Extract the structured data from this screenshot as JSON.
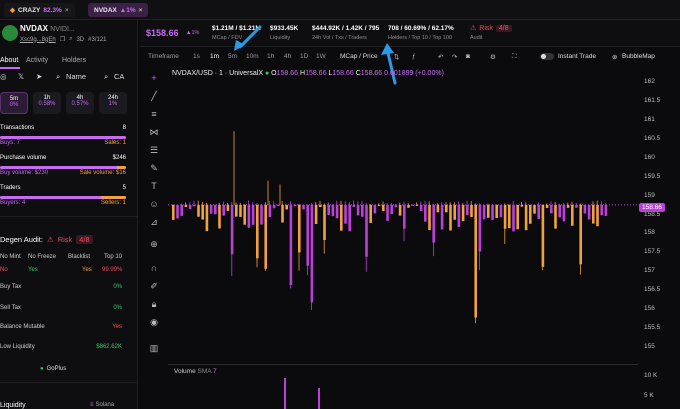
{
  "topbar": {
    "tab1_label": "CRAZY",
    "tab1_pct": "82.3%",
    "tab1_close": "×",
    "tab2_label": "NVDAX",
    "tab2_pct": "▲1%",
    "tab2_close": "×"
  },
  "token": {
    "name": "NVDAX",
    "name_suffix": "NVIDI...",
    "address": "Xsc9g...8gEh",
    "age": "3D",
    "rank": "#3/121"
  },
  "left_tabs": {
    "about": "About",
    "activity": "Activity",
    "holders": "Holders"
  },
  "social": {
    "name_label": "Name",
    "ca_label": "CA"
  },
  "timeframes": [
    {
      "label": "5m",
      "pct": "0%"
    },
    {
      "label": "1h",
      "pct": "0.58%"
    },
    {
      "label": "4h",
      "pct": "0.57%"
    },
    {
      "label": "24h",
      "pct": "1%"
    }
  ],
  "txn_stats": {
    "transactions_label": "Transactions",
    "transactions_value": "8",
    "buys": "Buys: 7",
    "sales": "Sales: 1",
    "purchase_volume_label": "Purchase volume",
    "purchase_volume_value": "$246",
    "buy_volume": "Buy volume: $230",
    "sale_volume": "Sale volume: $16",
    "traders_label": "Traders",
    "traders_value": "5",
    "buyers": "Buyers: 4",
    "sellers": "Sellers: 1"
  },
  "degen": {
    "title": "Degen Audit:",
    "risk_label": "Risk",
    "risk_value": "4/8",
    "col1": "No Mint",
    "col2": "No Freeze",
    "col3": "Blacklist",
    "col4": "Top 10",
    "v1": "No",
    "v2": "Yes",
    "v3": "Yes",
    "v4": "99.99%",
    "buy_tax_label": "Buy Tax",
    "buy_tax_value": "0%",
    "sell_tax_label": "Sell Tax",
    "sell_tax_value": "0%",
    "balance_mutable_label": "Balance Mutable",
    "balance_mutable_value": "Yes",
    "low_liquidity_label": "Low Liquidity",
    "low_liquidity_value": "$862.62K",
    "goplus": "GoPlus"
  },
  "footer_left": {
    "liquidity": "Liquidity",
    "chain": "Solana"
  },
  "stats": {
    "price": "$158.66",
    "price_change": "▲1%",
    "mcap": "$1.21M / $1.21M",
    "mcap_label": "MCap / FDV",
    "liquidity": "$933.45K",
    "liquidity_label": "Liquidity",
    "volume": "$444.92K / 1.42K / 795",
    "volume_label": "24h Vol / Txs / Traders",
    "holders": "708 / 60.69% / 62.17%",
    "holders_label": "Holders / Top 10 / Top 100",
    "risk_label": "Risk",
    "risk_value": "4/8",
    "audit_label": "Audit"
  },
  "toolbar": {
    "timeframe": "Timeframe",
    "intervals": [
      "1s",
      "1m",
      "5m",
      "10m",
      "1h",
      "4h",
      "1D",
      "1W"
    ],
    "mcap_price": "MCap / Price",
    "instant_trade": "Instant Trade",
    "bubblemap": "BubbleMap"
  },
  "chart_header": {
    "pair": "NVDAX/USD · 1 · UniversalX",
    "o_label": "O",
    "o_value": "158.66",
    "h_label": "H",
    "h_value": "158.66",
    "l_label": "L",
    "l_value": "158.66",
    "c_label": "C",
    "c_value": "158.66",
    "change": "0.001899 (+0.00%)"
  },
  "volume_label": {
    "name": "Volume",
    "sma": "SMA",
    "value": "7"
  },
  "yaxis_ticks": [
    "162",
    "161.5",
    "161",
    "160.5",
    "160",
    "159.5",
    "159",
    "158.5",
    "158",
    "157.5",
    "157",
    "156.5",
    "156",
    "155.5",
    "155"
  ],
  "price_badge": "158.66",
  "vol_ticks": [
    "10 K",
    "5 K"
  ],
  "colors": {
    "accent": "#c66cf0",
    "up": "#f0a23c",
    "down": "#b941d8",
    "risk": "#f04a5a",
    "green": "#35c96b"
  }
}
